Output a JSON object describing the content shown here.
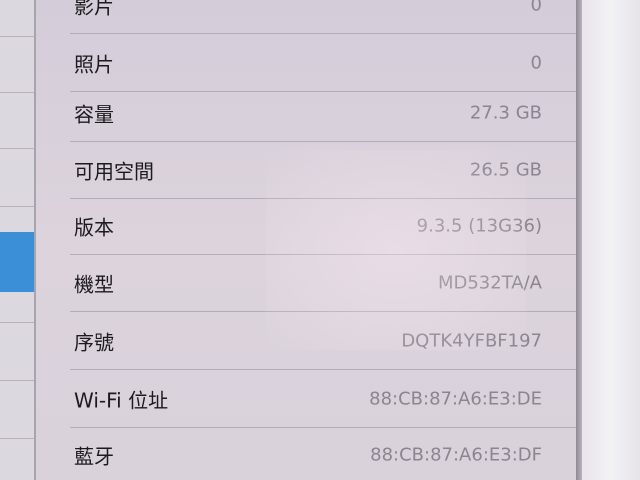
{
  "rows": [
    {
      "label": "影片",
      "value": "0"
    },
    {
      "label": "照片",
      "value": "0"
    },
    {
      "label": "容量",
      "value": "27.3 GB"
    },
    {
      "label": "可用空間",
      "value": "26.5 GB"
    },
    {
      "label": "版本",
      "value": "9.3.5 (13G36)"
    },
    {
      "label": "機型",
      "value": "MD532TA/A"
    },
    {
      "label": "序號",
      "value": "DQTK4YFBF197"
    },
    {
      "label": "Wi-Fi 位址",
      "value": "88:CB:87:A6:E3:DE"
    },
    {
      "label": "藍牙",
      "value": "88:CB:87:A6:E3:DF"
    }
  ],
  "colors": {
    "selected_accent": "#3a8fd6",
    "label_text": "#1c1a1f",
    "value_text": "#8a8590"
  }
}
